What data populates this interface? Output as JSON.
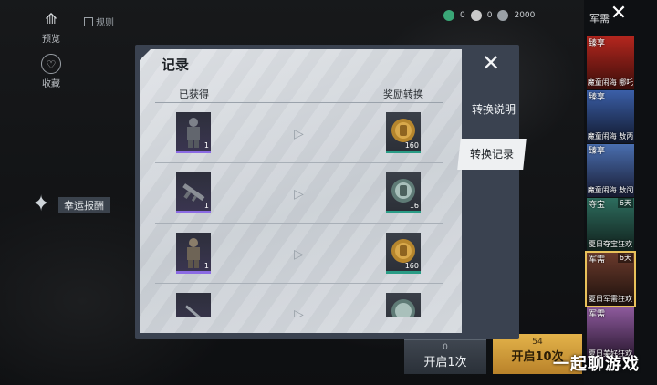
{
  "left_rail": {
    "wardrobe_label": "预览",
    "favorite_label": "收藏",
    "record_label": "规则",
    "lucky_label": "幸运报酬"
  },
  "top_currency": {
    "coupon": "0",
    "gold": "0",
    "extra": "2000"
  },
  "bottom": {
    "open_once_cost": "0",
    "open_once_label": "开启1次",
    "open_ten_cost": "54",
    "open_ten_label": "开启10次"
  },
  "side": {
    "title": "军需",
    "events": [
      {
        "tag": "臻享",
        "caption": "魔童闹海 哪吒",
        "days": "",
        "color": "#b3261e"
      },
      {
        "tag": "臻享",
        "caption": "魔童闹海 敖丙",
        "days": "",
        "color": "#3b5fa8"
      },
      {
        "tag": "臻享",
        "caption": "魔童闹海 敖闰",
        "days": "",
        "color": "#4a6fb0"
      },
      {
        "tag": "夺宝",
        "caption": "夏日夺宝狂欢",
        "days": "6天",
        "color": "#2d6d5e"
      },
      {
        "tag": "军需",
        "caption": "夏日军需狂欢",
        "days": "6天",
        "color": "#6b3a2c"
      },
      {
        "tag": "军需",
        "caption": "夏日美好狂欢",
        "days": "",
        "color": "#8d5a9c"
      }
    ]
  },
  "dialog": {
    "title": "记录",
    "col_obtained": "已获得",
    "col_reward": "奖励转换",
    "rows": [
      {
        "item_qty": "1",
        "reward_qty": "160",
        "item_kind": "outfit",
        "reward_kind": "gold"
      },
      {
        "item_qty": "1",
        "reward_qty": "16",
        "item_kind": "gun",
        "reward_kind": "silver"
      },
      {
        "item_qty": "1",
        "reward_qty": "160",
        "item_kind": "outfit",
        "reward_kind": "gold"
      },
      {
        "item_qty": "",
        "reward_qty": "",
        "item_kind": "knife",
        "reward_kind": "silver"
      }
    ],
    "tabs": {
      "explain": "转换说明",
      "record": "转换记录"
    }
  },
  "watermark": "一起聊游戏",
  "colors": {
    "item_bar": "#8b6be3",
    "reward_bar": "#2a9c86",
    "open_ten": "#e3b34a"
  }
}
